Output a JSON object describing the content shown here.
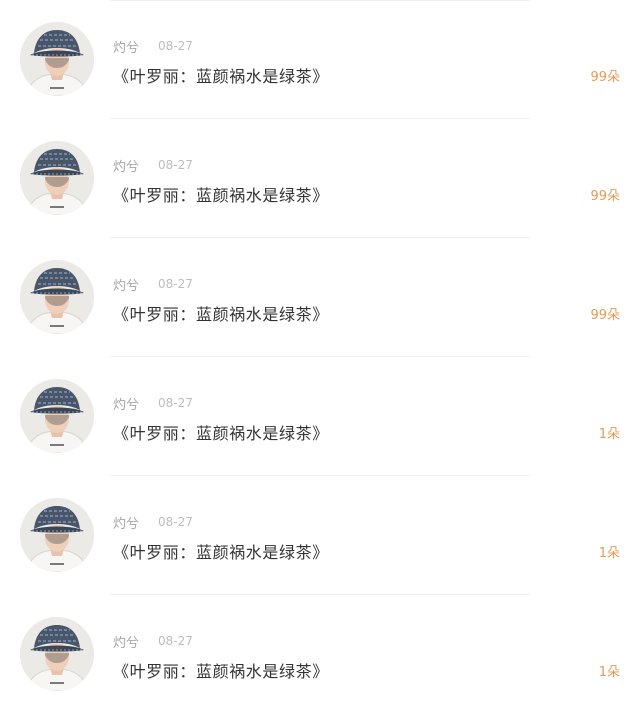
{
  "colors": {
    "author": "#a6a6a6",
    "date": "#bdbdbd",
    "title": "#333333",
    "count": "#e99a55",
    "divider": "#f1f1f1"
  },
  "items": [
    {
      "avatar_icon": "avatar-photo-bucket-hat",
      "author": "灼兮",
      "date": "08-27",
      "title": "《叶罗丽：蓝颜祸水是绿茶》",
      "count": "99朵"
    },
    {
      "avatar_icon": "avatar-photo-bucket-hat",
      "author": "灼兮",
      "date": "08-27",
      "title": "《叶罗丽：蓝颜祸水是绿茶》",
      "count": "99朵"
    },
    {
      "avatar_icon": "avatar-photo-bucket-hat",
      "author": "灼兮",
      "date": "08-27",
      "title": "《叶罗丽：蓝颜祸水是绿茶》",
      "count": "99朵"
    },
    {
      "avatar_icon": "avatar-photo-bucket-hat",
      "author": "灼兮",
      "date": "08-27",
      "title": "《叶罗丽：蓝颜祸水是绿茶》",
      "count": "1朵"
    },
    {
      "avatar_icon": "avatar-photo-bucket-hat",
      "author": "灼兮",
      "date": "08-27",
      "title": "《叶罗丽：蓝颜祸水是绿茶》",
      "count": "1朵"
    },
    {
      "avatar_icon": "avatar-photo-bucket-hat",
      "author": "灼兮",
      "date": "08-27",
      "title": "《叶罗丽：蓝颜祸水是绿茶》",
      "count": "1朵"
    }
  ]
}
